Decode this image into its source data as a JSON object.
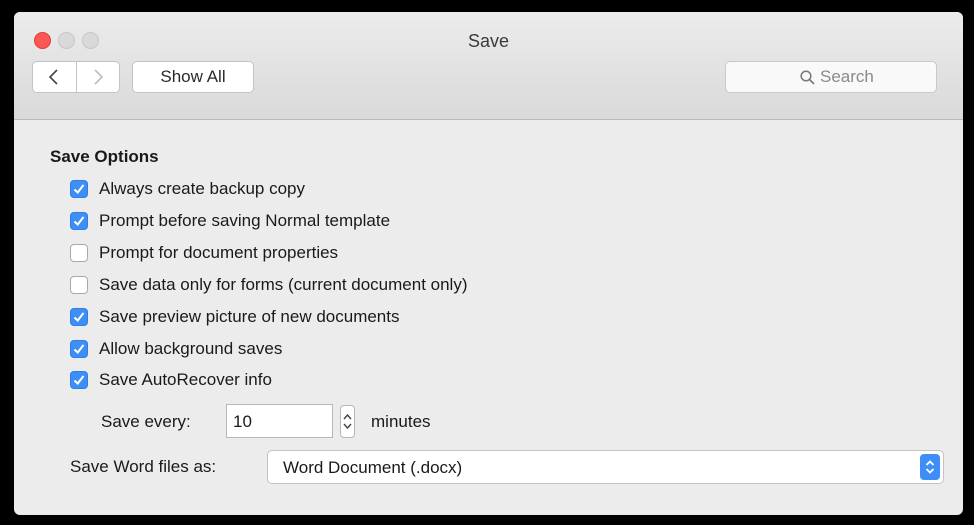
{
  "window": {
    "title": "Save"
  },
  "toolbar": {
    "show_all_label": "Show All",
    "search_placeholder": "Search"
  },
  "section": {
    "title": "Save Options"
  },
  "options": [
    {
      "label": "Always create backup copy",
      "checked": true
    },
    {
      "label": "Prompt before saving Normal template",
      "checked": true
    },
    {
      "label": "Prompt for document properties",
      "checked": false
    },
    {
      "label": "Save data only for forms (current document only)",
      "checked": false
    },
    {
      "label": "Save preview picture of new documents",
      "checked": true
    },
    {
      "label": "Allow background saves",
      "checked": true
    },
    {
      "label": "Save AutoRecover info",
      "checked": true
    }
  ],
  "autosave": {
    "label": "Save every:",
    "value": "10",
    "unit": "minutes"
  },
  "save_as": {
    "label": "Save Word files as:",
    "value": "Word Document (.docx)"
  },
  "colors": {
    "close_light": "#fc5753",
    "accent": "#3d8ef7"
  },
  "icons": {
    "back": "chevron-left-icon",
    "forward": "chevron-right-icon",
    "search": "magnifier-icon",
    "check": "checkmark-icon",
    "stepper": "up-down-arrows-icon",
    "popup": "up-down-arrows-icon"
  }
}
